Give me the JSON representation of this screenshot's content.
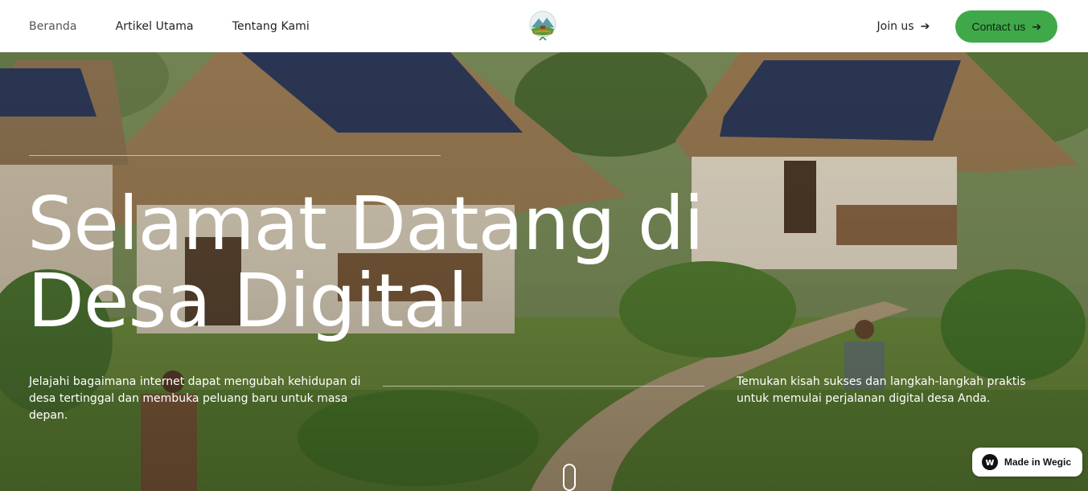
{
  "nav": {
    "links": [
      "Beranda",
      "Artikel Utama",
      "Tentang Kami"
    ],
    "join_label": "Join us",
    "contact_label": "Contact us",
    "arrow_icon": "arrow-right-icon",
    "logo_icon": "village-mountain-logo"
  },
  "hero": {
    "title_line1": "Selamat Datang di",
    "title_line2": "Desa Digital",
    "description_left": "Jelajahi bagaimana internet dapat mengubah kehidupan di desa tertinggal dan membuka peluang baru untuk masa depan.",
    "description_right": "Temukan kisah sukses dan langkah-langkah praktis untuk memulai perjalanan digital desa Anda.",
    "background_icon": "village-solar-houses-photo"
  },
  "badge": {
    "label": "Made in Wegic",
    "icon": "wegic-logo-icon"
  },
  "colors": {
    "accent": "#3fa94a",
    "header_bg": "#ffffff",
    "hero_text": "#ffffff"
  }
}
